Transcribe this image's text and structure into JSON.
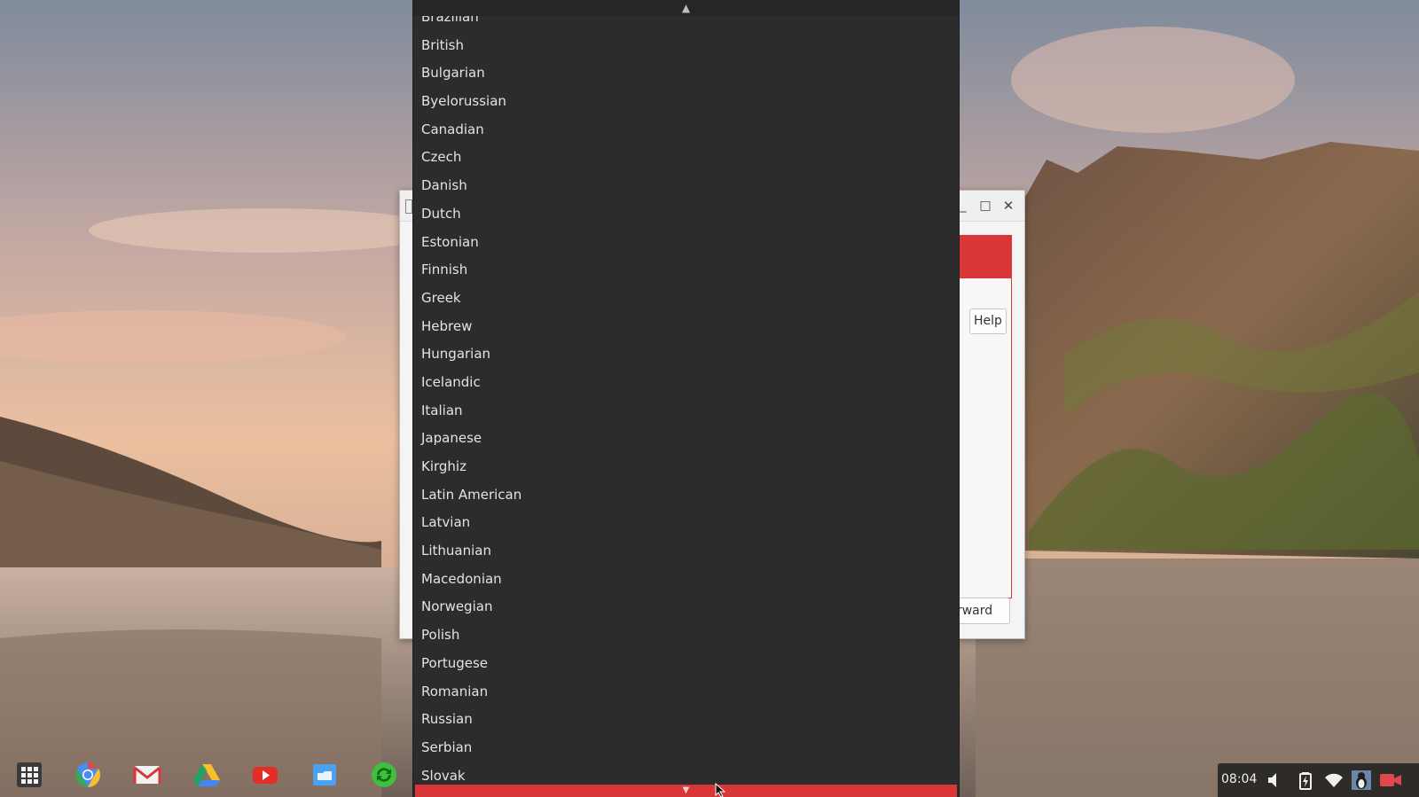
{
  "colors": {
    "dropdown_bg": "#2c2c2c",
    "dropdown_text": "#e3e3e3",
    "accent_red": "#d9363a",
    "window_bg": "#f4f4f4"
  },
  "dropdown": {
    "scroll_up_icon": "triangle-up-icon",
    "scroll_down_icon": "triangle-down-icon",
    "items": [
      "Brazilian",
      "British",
      "Bulgarian",
      "Byelorussian",
      "Canadian",
      "Czech",
      "Danish",
      "Dutch",
      "Estonian",
      "Finnish",
      "Greek",
      "Hebrew",
      "Hungarian",
      "Icelandic",
      "Italian",
      "Japanese",
      "Kirghiz",
      "Latin American",
      "Latvian",
      "Lithuanian",
      "Macedonian",
      "Norwegian",
      "Polish",
      "Portugese",
      "Romanian",
      "Russian",
      "Serbian",
      "Slovak"
    ]
  },
  "background_window": {
    "help_label": "Help",
    "forward_label": "Forward"
  },
  "shelf": {
    "apps": [
      "app-launcher-icon",
      "chrome-icon",
      "gmail-icon",
      "drive-icon",
      "youtube-icon",
      "files-icon",
      "sync-app-icon"
    ]
  },
  "status": {
    "time": "08:04",
    "icons": [
      "volume-icon",
      "battery-icon",
      "wifi-icon",
      "user-avatar-icon",
      "screen-record-icon"
    ]
  }
}
